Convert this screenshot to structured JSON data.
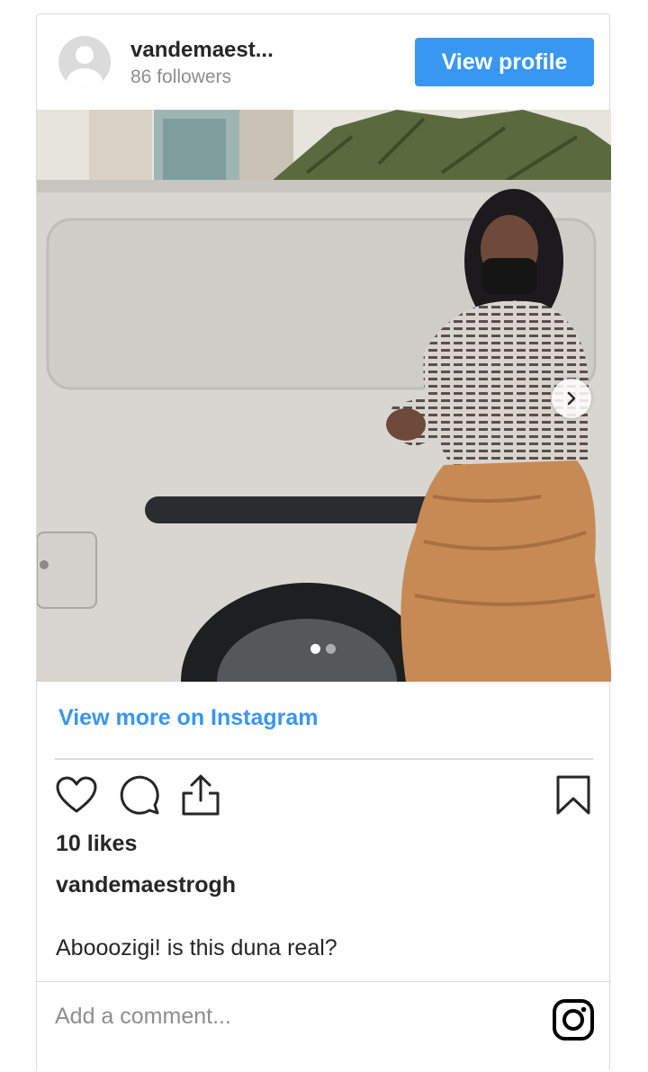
{
  "header": {
    "username": "vandemaest...",
    "followers": "86 followers",
    "view_profile_label": "View profile",
    "avatar_icon": "default-avatar-icon"
  },
  "media": {
    "carousel_index": 1,
    "carousel_total": 2,
    "next_icon": "chevron-right-icon"
  },
  "view_more_label": "View more on Instagram",
  "actions": {
    "like_icon": "heart-icon",
    "comment_icon": "comment-icon",
    "share_icon": "share-icon",
    "save_icon": "bookmark-icon"
  },
  "likes": "10 likes",
  "post": {
    "owner": "vandemaestrogh",
    "caption": "Abooozigi! is this duna real?"
  },
  "comment": {
    "placeholder": "Add a comment...",
    "brand_icon": "instagram-icon"
  },
  "colors": {
    "accent": "#3897f0",
    "text": "#262626",
    "muted": "#8e8e8e",
    "border": "#dbdbdb"
  }
}
